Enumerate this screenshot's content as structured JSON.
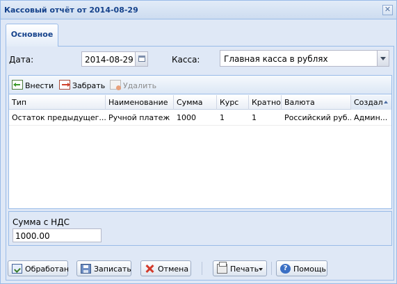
{
  "window": {
    "title": "Кассовый отчёт от 2014-08-29",
    "close_icon": "close-icon"
  },
  "tabs": [
    {
      "label": "Основное",
      "active": true
    }
  ],
  "form": {
    "date_label": "Дата:",
    "date_value": "2014-08-29",
    "cashbox_label": "Касса:",
    "cashbox_value": "Главная касса в рублях"
  },
  "grid_toolbar": {
    "add_label": "Внести",
    "withdraw_label": "Забрать",
    "delete_label": "Удалить"
  },
  "grid": {
    "columns": [
      "Тип",
      "Наименование",
      "Сумма",
      "Курс",
      "Кратнос",
      "Валюта",
      "Создал"
    ],
    "sorted_column": "Создал",
    "rows": [
      [
        "Остаток предыдущег...",
        "Ручной платеж",
        "1000",
        "1",
        "1",
        "Российский руб...",
        "Админ..."
      ]
    ]
  },
  "sum": {
    "label": "Сумма с НДС",
    "value": "1000.00"
  },
  "buttons": {
    "process": "Обработан",
    "save": "Записать",
    "cancel": "Отмена",
    "print": "Печать",
    "help": "Помощь"
  },
  "colors": {
    "window_bg": "#dfe8f6",
    "border": "#99bbe8",
    "title_text": "#15428b"
  }
}
